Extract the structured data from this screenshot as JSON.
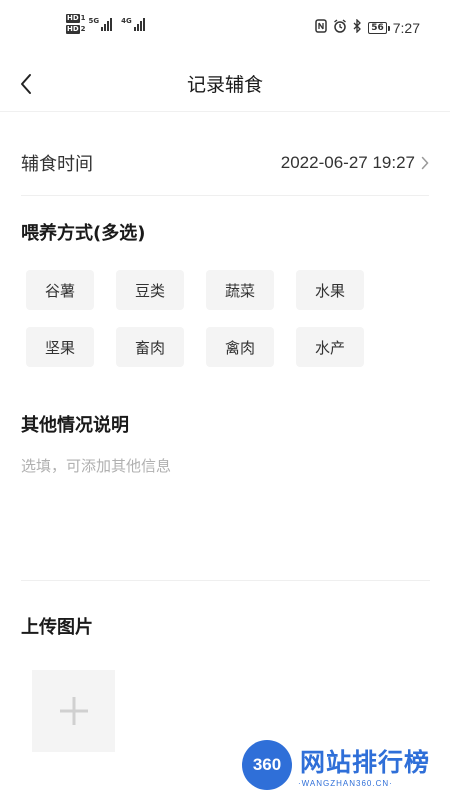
{
  "status_bar": {
    "hd_1": "HD",
    "sim_1": "1",
    "hd_2": "HD",
    "sim_2": "2",
    "net_1": "5G",
    "net_2": "4G",
    "battery": "56",
    "time": "7:27",
    "icons": [
      "nfc-icon",
      "alarm-icon",
      "bluetooth-icon"
    ]
  },
  "nav": {
    "title": "记录辅食"
  },
  "feed_time": {
    "label": "辅食时间",
    "value": "2022-06-27 19:27"
  },
  "feed_method": {
    "title": "喂养方式(多选)",
    "options": [
      "谷薯",
      "豆类",
      "蔬菜",
      "水果",
      "坚果",
      "畜肉",
      "禽肉",
      "水产"
    ]
  },
  "notes": {
    "title": "其他情况说明",
    "placeholder": "选填，可添加其他信息",
    "value": ""
  },
  "upload": {
    "title": "上传图片"
  },
  "watermark": {
    "number": "360",
    "text": "网站排行榜",
    "url": "·WANGZHAN360.CN·",
    "color": "#2f6fd8"
  }
}
